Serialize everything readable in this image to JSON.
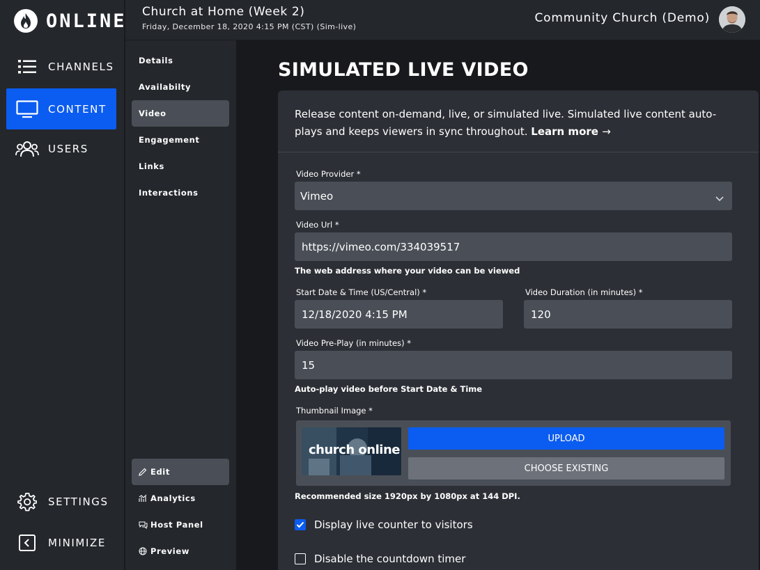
{
  "brand": {
    "name": "ONLINE"
  },
  "main_nav": [
    {
      "label": "CHANNELS",
      "icon": "list-icon"
    },
    {
      "label": "CONTENT",
      "icon": "monitor-icon",
      "active": true
    },
    {
      "label": "USERS",
      "icon": "users-icon"
    }
  ],
  "bottom_nav": [
    {
      "label": "SETTINGS",
      "icon": "gear-icon"
    },
    {
      "label": "MINIMIZE",
      "icon": "collapse-icon"
    }
  ],
  "header": {
    "event_title": "Church at Home (Week 2)",
    "event_date": "Friday, December 18, 2020 4:15 PM (CST) (Sim-live)",
    "org_name": "Community Church (Demo)"
  },
  "sub_nav": [
    {
      "label": "Details"
    },
    {
      "label": "Availabilty"
    },
    {
      "label": "Video",
      "active": true
    },
    {
      "label": "Engagement"
    },
    {
      "label": "Links"
    },
    {
      "label": "Interactions"
    }
  ],
  "sub_nav_bottom": [
    {
      "label": "Edit",
      "icon": "pencil-icon",
      "active": true
    },
    {
      "label": "Analytics",
      "icon": "analytics-icon"
    },
    {
      "label": "Host Panel",
      "icon": "chat-icon"
    },
    {
      "label": "Preview",
      "icon": "globe-icon"
    }
  ],
  "page": {
    "title": "SIMULATED LIVE VIDEO",
    "intro": "Release content on-demand, live, or simulated live. Simulated live content auto-plays and keeps viewers in sync throughout.",
    "learn_more": "Learn more",
    "learn_more_arrow": "→"
  },
  "form": {
    "provider_label": "Video Provider *",
    "provider_value": "Vimeo",
    "url_label": "Video Url *",
    "url_value": "https://vimeo.com/334039517",
    "url_help": "The web address where your video can be viewed",
    "start_label": "Start Date & Time (US/Central) *",
    "start_value": "12/18/2020 4:15 PM",
    "duration_label": "Video Duration (in minutes) *",
    "duration_value": "120",
    "preplay_label": "Video Pre-Play (in minutes) *",
    "preplay_value": "15",
    "preplay_help": "Auto-play video before Start Date & Time",
    "thumb_label": "Thumbnail Image *",
    "thumb_text": "church online",
    "upload_label": "UPLOAD",
    "choose_label": "CHOOSE EXISTING",
    "thumb_help": "Recommended size 1920px by 1080px at 144 DPI.",
    "counter_label": "Display live counter to visitors",
    "counter_checked": true,
    "countdown_label": "Disable the countdown timer",
    "countdown_checked": false
  },
  "colors": {
    "accent": "#0b5cf0",
    "sidebar": "#24272c",
    "card": "#2c2f35",
    "field": "#4a4f57",
    "background": "#18191c"
  }
}
